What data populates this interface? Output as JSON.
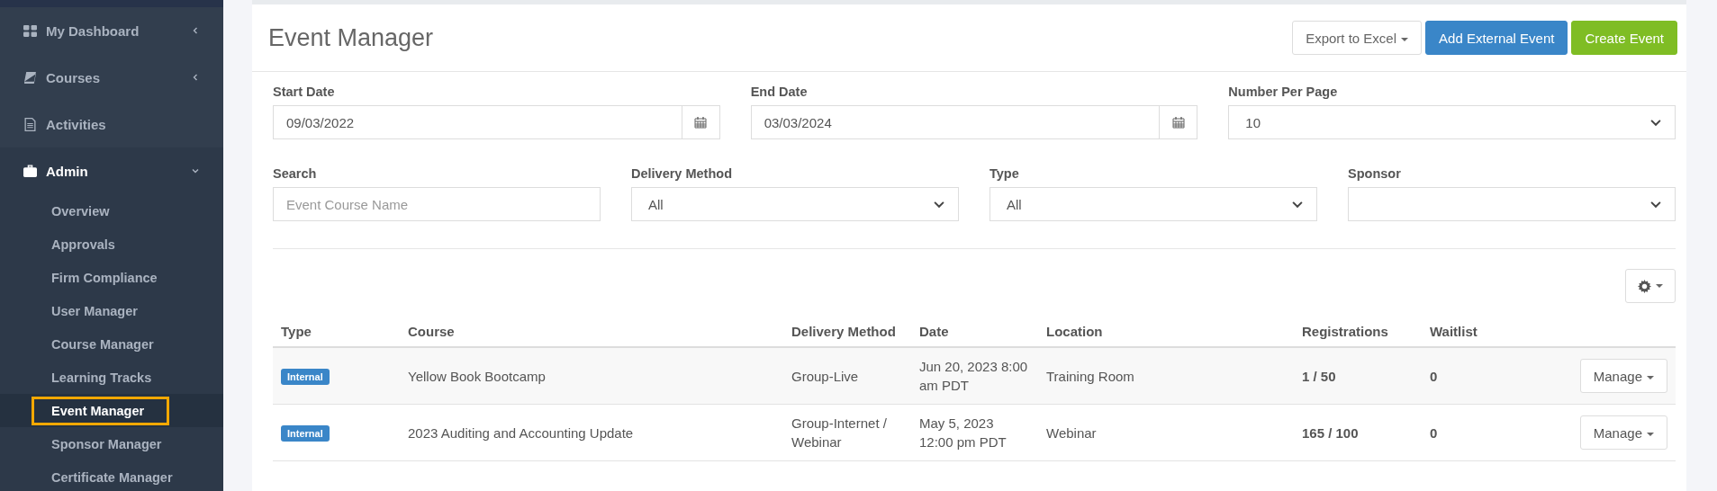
{
  "sidebar": {
    "items": [
      {
        "label": "My Dashboard",
        "expanded": false
      },
      {
        "label": "Courses",
        "expanded": false
      },
      {
        "label": "Activities"
      },
      {
        "label": "Admin",
        "expanded": true,
        "children": [
          {
            "label": "Overview",
            "selected": false
          },
          {
            "label": "Approvals",
            "selected": false
          },
          {
            "label": "Firm Compliance",
            "selected": false
          },
          {
            "label": "User Manager",
            "selected": false
          },
          {
            "label": "Course Manager",
            "selected": false
          },
          {
            "label": "Learning Tracks",
            "selected": false
          },
          {
            "label": "Event Manager",
            "selected": true
          },
          {
            "label": "Sponsor Manager",
            "selected": false
          },
          {
            "label": "Certificate Manager",
            "selected": false
          }
        ]
      }
    ]
  },
  "page": {
    "title": "Event Manager",
    "buttons": [
      {
        "label": "Export to Excel",
        "kind": "dropdown"
      },
      {
        "label": "Add External Event",
        "kind": "primary"
      },
      {
        "label": "Create Event",
        "kind": "success"
      }
    ]
  },
  "filters_row_1": [
    {
      "label": "Start Date",
      "kind": "date",
      "value": "09/03/2022"
    },
    {
      "label": "End Date",
      "kind": "date",
      "value": "03/03/2024"
    },
    {
      "label": "Number Per Page",
      "kind": "select",
      "value": "10"
    }
  ],
  "filters_row_2": [
    {
      "label": "Search",
      "kind": "text",
      "placeholder": "Event Course Name"
    },
    {
      "label": "Delivery Method",
      "kind": "select",
      "value": "All"
    },
    {
      "label": "Type",
      "kind": "select",
      "value": "All"
    },
    {
      "label": "Sponsor",
      "kind": "select"
    }
  ],
  "table": {
    "columns": [
      "Type",
      "Course",
      "Delivery Method",
      "Date",
      "Location",
      "Registrations",
      "Waitlist"
    ],
    "rows": [
      {
        "type": "Internal",
        "course": "Yellow Book Bootcamp",
        "delivery": "Group-Live",
        "date": "Jun 20, 2023 8:00 am PDT",
        "location": "Training Room",
        "registrations": "1 / 50",
        "waitlist": "0",
        "action": "Manage"
      },
      {
        "type": "Internal",
        "course": "2023 Auditing and Accounting Update",
        "delivery": "Group-Internet / Webinar",
        "date": "May 5, 2023 12:00 pm PDT",
        "location": "Webinar",
        "registrations": "165 / 100",
        "waitlist": "0",
        "action": "Manage"
      }
    ]
  }
}
